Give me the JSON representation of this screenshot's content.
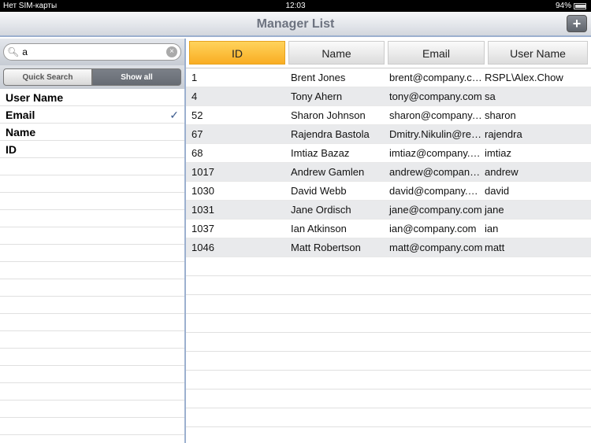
{
  "status": {
    "carrier": "Нет SIM-карты",
    "time": "12:03",
    "battery": "94%"
  },
  "nav": {
    "title": "Manager List",
    "add_label": "+"
  },
  "search": {
    "value": "a",
    "clear": "×",
    "icon": "search-icon"
  },
  "segments": {
    "quick": "Quick Search",
    "all": "Show all",
    "selected": "Show all"
  },
  "fields": [
    {
      "label": "User Name",
      "checked": false
    },
    {
      "label": "Email",
      "checked": true
    },
    {
      "label": "Name",
      "checked": false
    },
    {
      "label": "ID",
      "checked": false
    }
  ],
  "check": "✓",
  "table": {
    "columns": [
      "ID",
      "Name",
      "Email",
      "User Name"
    ],
    "sorted": "ID",
    "rows": [
      [
        "1",
        "Brent Jones",
        "brent@company.com",
        "RSPL\\Alex.Chow"
      ],
      [
        "4",
        "Tony Ahern",
        "tony@company.com",
        "sa"
      ],
      [
        "52",
        "Sharon Johnson",
        "sharon@company.com",
        "sharon"
      ],
      [
        "67",
        "Rajendra Bastola",
        "Dmitry.Nikulin@recruit.com",
        "rajendra"
      ],
      [
        "68",
        "Imtiaz Bazaz",
        "imtiaz@company.com",
        "imtiaz"
      ],
      [
        "1017",
        "Andrew Gamlen",
        "andrew@company.com",
        "andrew"
      ],
      [
        "1030",
        "David Webb",
        "david@company.com",
        "david"
      ],
      [
        "1031",
        "Jane Ordisch",
        "jane@company.com",
        "jane"
      ],
      [
        "1037",
        "Ian Atkinson",
        "ian@company.com",
        "ian"
      ],
      [
        "1046",
        "Matt Robertson",
        "matt@company.com",
        "matt"
      ]
    ]
  }
}
